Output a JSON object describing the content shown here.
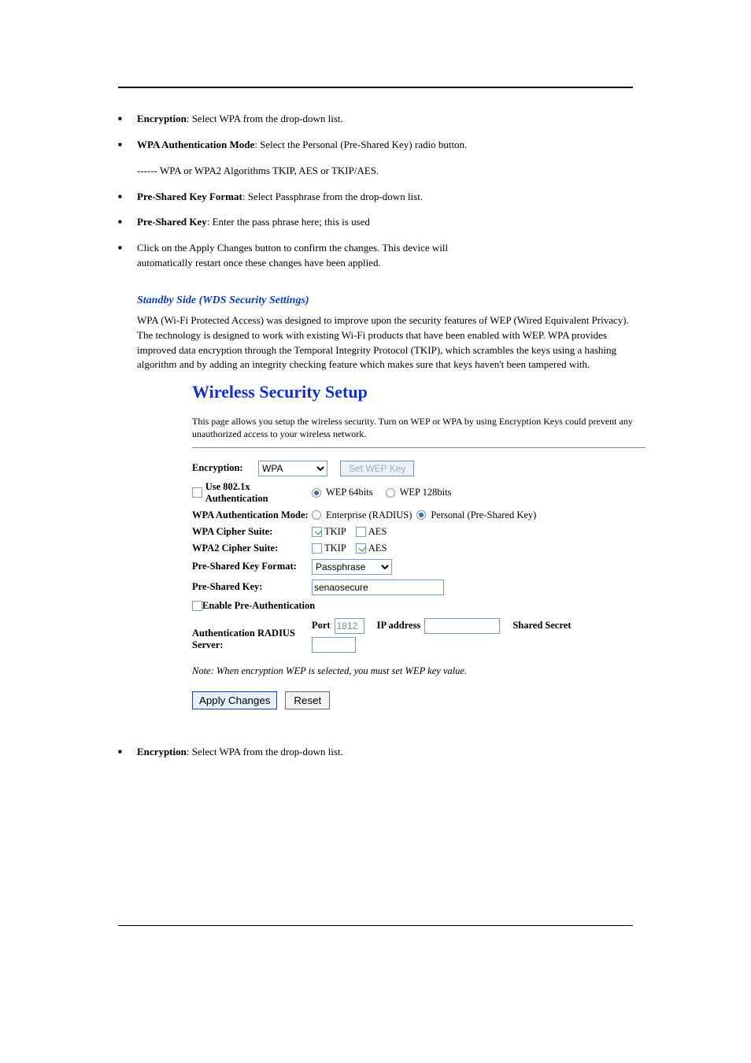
{
  "bullets": {
    "b1": {
      "label": "Encryption",
      "text": ": Select WPA from the drop-down list."
    },
    "b2": {
      "label": "WPA Authentication Mode",
      "text": ": Select the Personal (Pre-Shared Key) radio button."
    },
    "b2_cont": "------ WPA or WPA2 Algorithms TKIP, AES or TKIP/AES.",
    "b3": {
      "label": "Pre-Shared Key Format",
      "text": ": Select Passphrase from the drop-down list."
    },
    "b4": {
      "label": "Pre-Shared Key",
      "text": ": Enter the pass phrase here; this is used"
    },
    "b5_line1": "Click on the Apply Changes button to confirm the changes. This device will",
    "b5_line2": "automatically restart once these changes have been applied."
  },
  "std_heading": "Standby Side (WDS Security Settings)",
  "std_intro_1": "WPA (Wi-Fi Protected Access) was designed to improve upon the security features of WEP (Wired Equivalent Privacy). The technology is designed to work with existing Wi-Fi products that have been enabled with WEP. WPA provides improved data encryption through the Temporal Integrity Protocol (TKIP), which scrambles the keys using a hashing algorithm and by adding an integrity checking feature which makes sure that keys haven't been tampered with.",
  "shot": {
    "title": "Wireless Security Setup",
    "desc": "This page allows you setup the wireless security. Turn on WEP or WPA by using Encryption Keys could prevent any unauthorized access to your wireless network.",
    "encryption_label": "Encryption:",
    "encryption_value": "WPA",
    "setwep_btn": "Set WEP Key",
    "use8021x_label": "Use 802.1x Authentication",
    "wep64": "WEP 64bits",
    "wep128": "WEP 128bits",
    "wpa_authmode_label": "WPA Authentication Mode:",
    "enterprise": "Enterprise (RADIUS)",
    "personal": "Personal (Pre-Shared Key)",
    "wpa_cipher_label": "WPA Cipher Suite:",
    "wpa2_cipher_label": "WPA2 Cipher Suite:",
    "tkip": "TKIP",
    "aes": "AES",
    "pskfmt_label": "Pre-Shared Key Format:",
    "pskfmt_value": "Passphrase",
    "psk_label": "Pre-Shared Key:",
    "psk_value": "senaosecure",
    "preauth_label": "Enable Pre-Authentication",
    "radius_label": "Authentication RADIUS Server:",
    "port_lbl": "Port",
    "port_val": "1812",
    "ip_lbl": "IP address",
    "secret_lbl": "Shared Secret",
    "note": "Note: When encryption WEP is selected, you must set WEP key value.",
    "apply": "Apply Changes",
    "reset": "Reset"
  },
  "after_bullet": {
    "label": "Encryption",
    "text": ": Select WPA from the drop-down list."
  }
}
